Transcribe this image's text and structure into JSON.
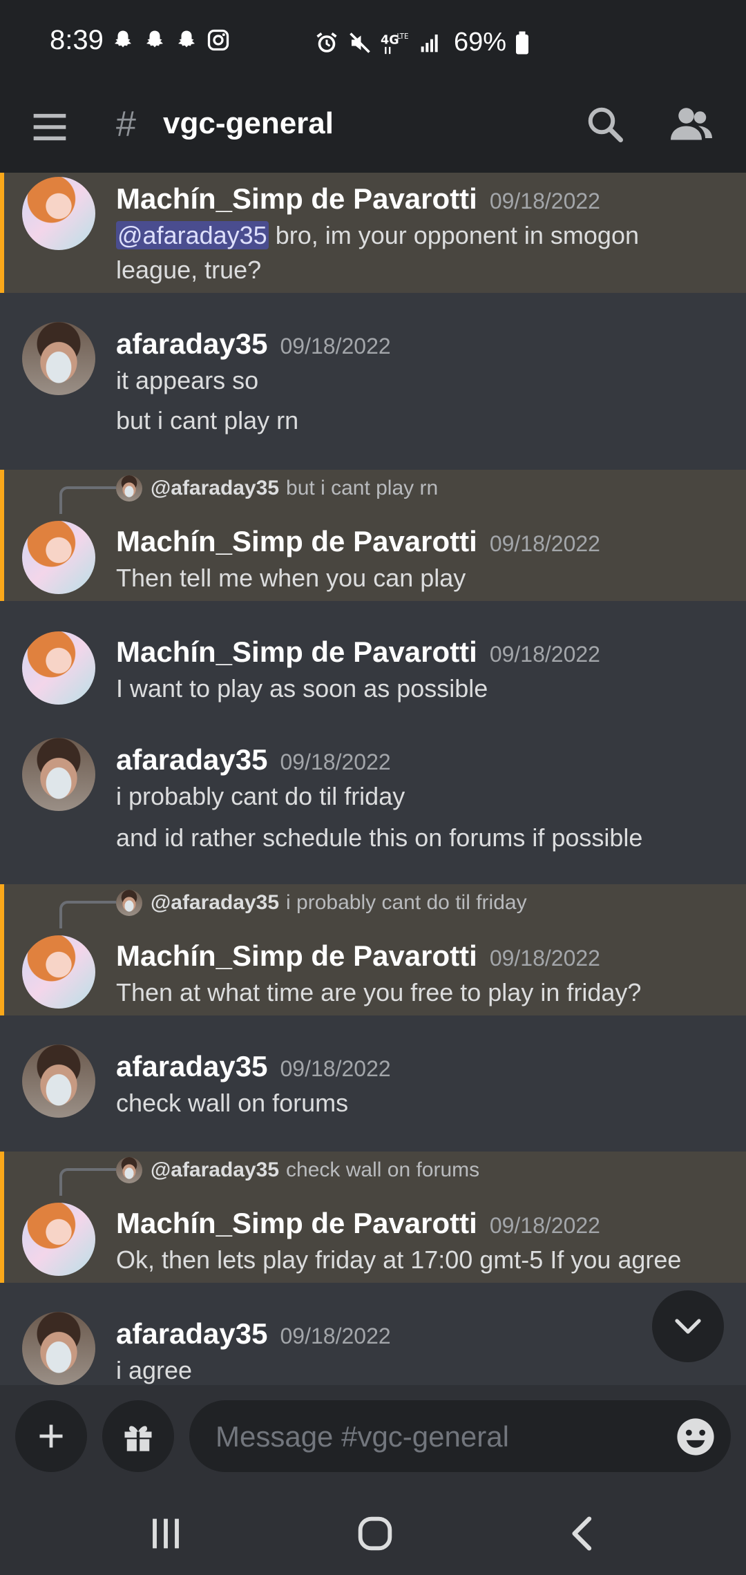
{
  "status_bar": {
    "time": "8:39",
    "battery": "69%",
    "network": "4G"
  },
  "header": {
    "channel_prefix": "#",
    "channel_name": "vgc-general"
  },
  "messages": [
    {
      "author": "Machín_Simp de Pavarotti",
      "timestamp": "09/18/2022",
      "mention": "@afaraday35",
      "lines": [
        " bro, im your opponent in smogon",
        "league, true?"
      ],
      "highlighted": true
    },
    {
      "author": "afaraday35",
      "timestamp": "09/18/2022",
      "lines": [
        "it appears so",
        "but i cant play rn"
      ]
    },
    {
      "author": "Machín_Simp de Pavarotti",
      "timestamp": "09/18/2022",
      "reply_to": {
        "author": "@afaraday35",
        "text": "but i cant play rn"
      },
      "lines": [
        "Then tell me when you can play"
      ],
      "highlighted": true
    },
    {
      "author": "Machín_Simp de Pavarotti",
      "timestamp": "09/18/2022",
      "lines": [
        "I want to play as soon as possible"
      ]
    },
    {
      "author": "afaraday35",
      "timestamp": "09/18/2022",
      "lines": [
        "i probably cant do til friday",
        "and id rather schedule this on forums if possible"
      ]
    },
    {
      "author": "Machín_Simp de Pavarotti",
      "timestamp": "09/18/2022",
      "reply_to": {
        "author": "@afaraday35",
        "text": "i probably cant do til friday"
      },
      "lines": [
        "Then at what time are you free to play in friday?"
      ],
      "highlighted": true
    },
    {
      "author": "afaraday35",
      "timestamp": "09/18/2022",
      "lines": [
        "check wall on forums"
      ]
    },
    {
      "author": "Machín_Simp de Pavarotti",
      "timestamp": "09/18/2022",
      "reply_to": {
        "author": "@afaraday35",
        "text": "check wall on forums"
      },
      "lines": [
        "Ok, then lets play friday at 17:00 gmt-5 If you agree"
      ],
      "highlighted": true
    },
    {
      "author": "afaraday35",
      "timestamp": "09/18/2022",
      "lines": [
        "i agree"
      ]
    }
  ],
  "composer": {
    "placeholder": "Message #vgc-general"
  },
  "icons": {
    "menu": "hamburger-menu-icon",
    "search": "search-icon",
    "members": "members-icon",
    "add": "plus-icon",
    "gift": "gift-icon",
    "emoji": "emoji-icon",
    "jump": "chevron-down-icon"
  },
  "colors": {
    "highlight_bar": "#faa81a",
    "highlight_bg": "#494640",
    "background": "#36393f",
    "header_bg": "#202225"
  }
}
